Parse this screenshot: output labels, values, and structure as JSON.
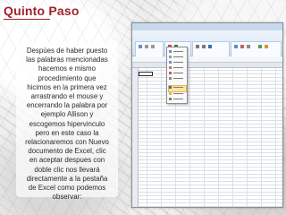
{
  "slide": {
    "title": "Quinto Paso",
    "caption": "Despúes de haber puesto\nlas palabras mencionadas\nhacemos e mismo\nprocedimiento que\nhicimos en la primera vez\narrastrando el mouse y\nencerrando la palabra por\nejemplo Allison y\nescogemos hipervinculo\npero en este caso la\nrelacionaremos con Nuevo\ndocumento de Excel, clic\nen aceptar despues con\ndoble clic  nos llevará\ndirectamente a la pestaña\nde Excel como podemos\nobservar:"
  },
  "colors": {
    "title": "#a0222a",
    "ribbon": "#d5e3f3",
    "highlight": "#ffe3a3"
  },
  "screenshot": {
    "app": "Excel",
    "icons": [
      "cut-icon",
      "copy-icon",
      "paste-icon",
      "hyperlink-icon",
      "insert-icon",
      "delete-icon",
      "format-icon",
      "comment-icon",
      "sort-icon",
      "filter-icon",
      "chart-icon"
    ]
  }
}
